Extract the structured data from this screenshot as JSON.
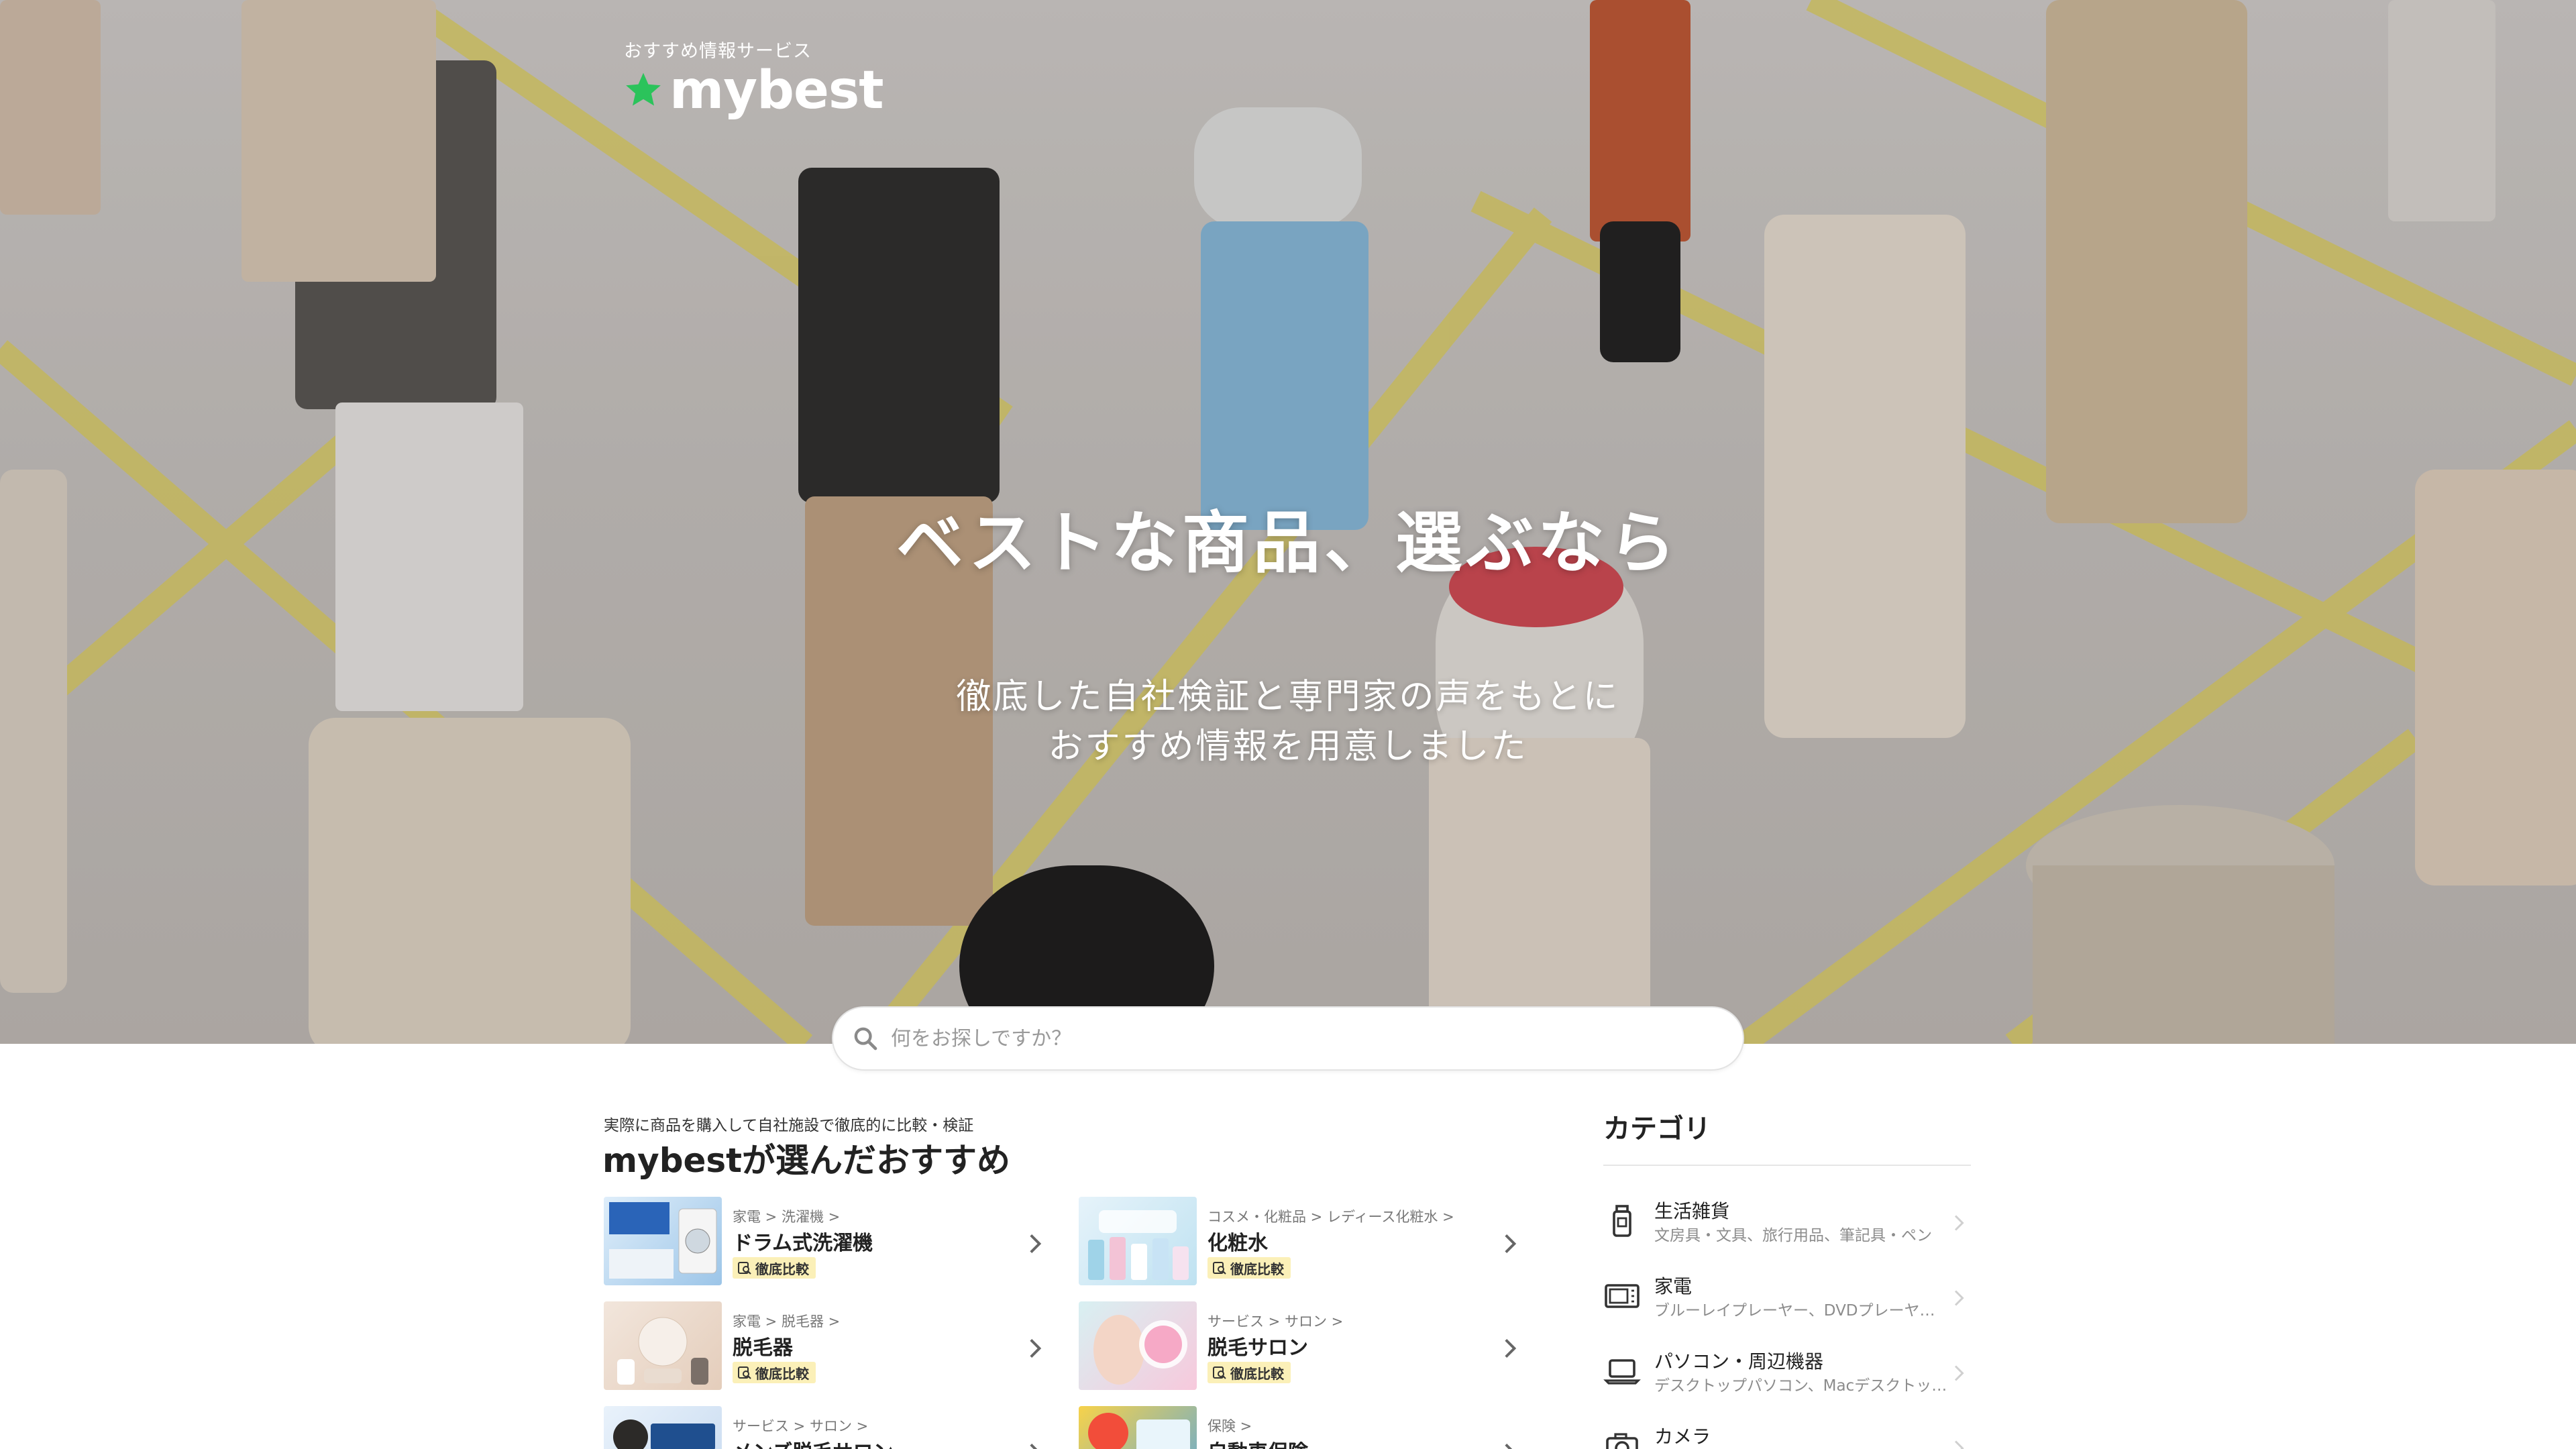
{
  "header": {
    "tagline": "おすすめ情報サービス",
    "logo_text": "mybest",
    "logo_icon": "star-icon",
    "brand_color": "#2bc35b"
  },
  "hero": {
    "title": "ベストな商品、選ぶなら",
    "subtitle_line1": "徹底した自社検証と専門家の声をもとに",
    "subtitle_line2": "おすすめ情報を用意しました"
  },
  "search": {
    "placeholder": "何をお探しですか？",
    "value": "",
    "icon": "search-icon"
  },
  "recommendations": {
    "subtitle": "実際に商品を購入して自社施設で徹底的に比較・検証",
    "title": "mybestが選んだおすすめ",
    "badge_color": "#fbf0b8",
    "items": [
      {
        "crumb": "家電 > 洗濯機 >",
        "name": "ドラム式洗濯機",
        "badge": "徹底比較",
        "thumb_text": "ドラム式洗濯機"
      },
      {
        "crumb": "コスメ・化粧品 > レディース化粧水 >",
        "name": "化粧水",
        "badge": "徹底比較",
        "thumb_text": "化粧水"
      },
      {
        "crumb": "家電 > 脱毛器 >",
        "name": "脱毛器",
        "badge": "徹底比較",
        "thumb_text": "脱毛器"
      },
      {
        "crumb": "サービス > サロン >",
        "name": "脱毛サロン",
        "badge": "徹底比較",
        "thumb_text": "脱毛サロン"
      },
      {
        "crumb": "サービス > サロン >",
        "name": "メンズ脱毛サロン",
        "badge": "",
        "thumb_text": "メンズ"
      },
      {
        "crumb": "保険 >",
        "name": "自動車保険",
        "badge": "",
        "thumb_text": ""
      }
    ]
  },
  "categories": {
    "title": "カテゴリ",
    "items": [
      {
        "name": "生活雑貨",
        "desc": "文房具・文具、旅行用品、筆記具・ペン",
        "icon": "bottle-icon"
      },
      {
        "name": "家電",
        "desc": "ブルーレイプレーヤー、DVDプレーヤー…",
        "icon": "microwave-icon"
      },
      {
        "name": "パソコン・周辺機器",
        "desc": "デスクトップパソコン、Macデスクトッ…",
        "icon": "laptop-icon"
      },
      {
        "name": "カメラ",
        "desc": "",
        "icon": "camera-icon"
      }
    ]
  }
}
